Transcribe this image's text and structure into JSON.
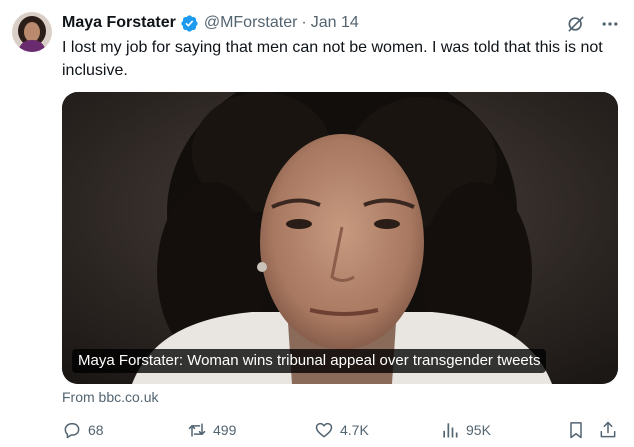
{
  "author": {
    "name": "Maya Forstater",
    "handle": "@MForstater",
    "separator": "·",
    "date": "Jan 14",
    "verified": true
  },
  "tweet": {
    "text": "I lost my job for saying that men can not be women. I was told that this is not inclusive."
  },
  "card": {
    "caption": "Maya Forstater: Woman wins tribunal appeal over transgender tweets",
    "source": "From bbc.co.uk"
  },
  "actions": {
    "replies": "68",
    "retweets": "499",
    "likes": "4.7K",
    "views": "95K"
  },
  "icons": {
    "verified": "verified-badge-icon",
    "grok": "grok-icon",
    "more": "more-icon",
    "reply": "reply-icon",
    "retweet": "retweet-icon",
    "like": "heart-icon",
    "views": "views-icon",
    "bookmark": "bookmark-icon",
    "share": "share-icon"
  },
  "colors": {
    "text": "#0f1419",
    "secondary": "#536471",
    "verified": "#1d9bf0",
    "background": "#ffffff"
  }
}
